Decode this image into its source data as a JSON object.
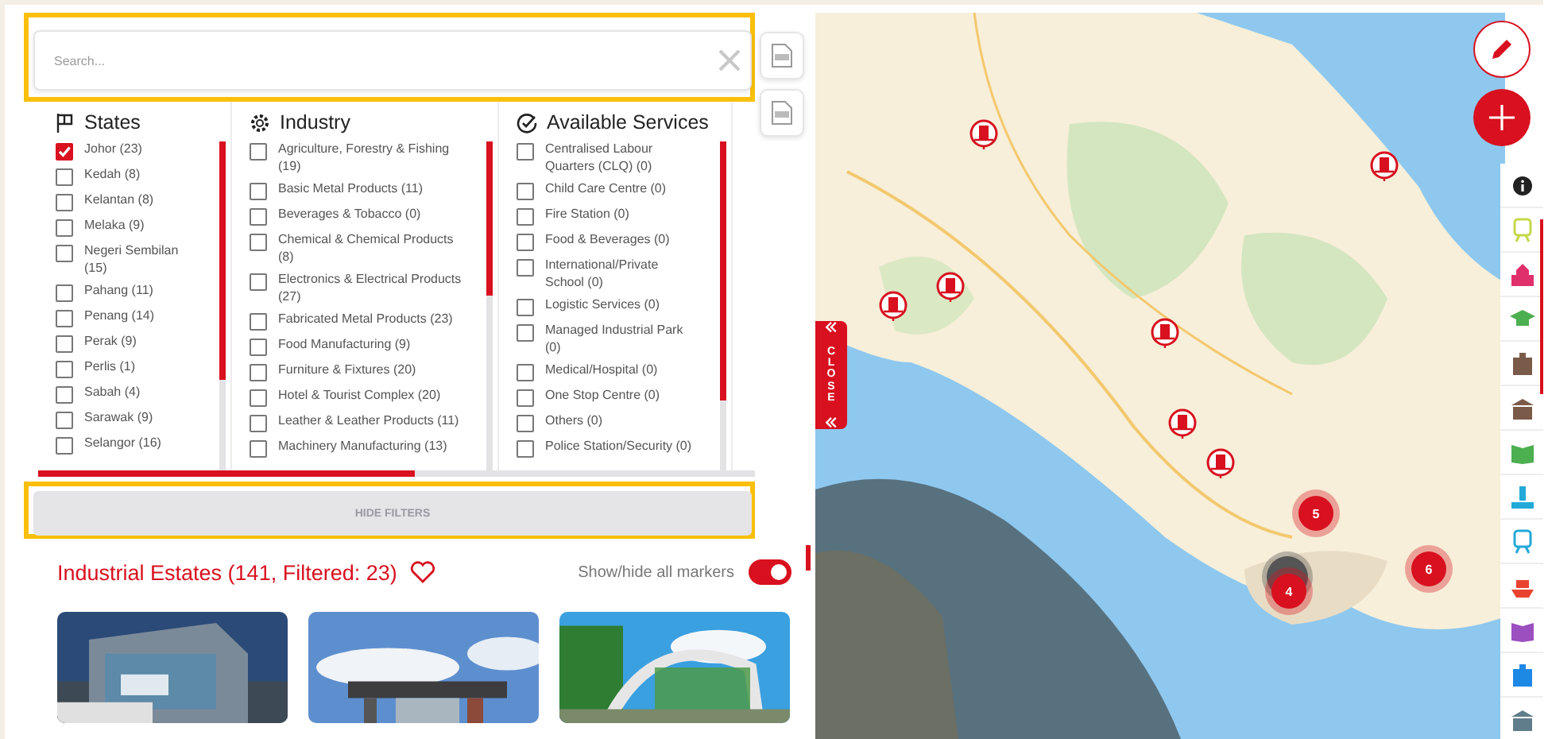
{
  "search": {
    "placeholder": "Search..."
  },
  "filters": [
    {
      "title": "States",
      "kind": "flag",
      "options": [
        {
          "label": "Johor (23)",
          "checked": true
        },
        {
          "label": "Kedah (8)",
          "checked": false
        },
        {
          "label": "Kelantan (8)",
          "checked": false
        },
        {
          "label": "Melaka (9)",
          "checked": false
        },
        {
          "label": "Negeri Sembilan (15)",
          "checked": false
        },
        {
          "label": "Pahang (11)",
          "checked": false
        },
        {
          "label": "Penang (14)",
          "checked": false
        },
        {
          "label": "Perak (9)",
          "checked": false
        },
        {
          "label": "Perlis (1)",
          "checked": false
        },
        {
          "label": "Sabah (4)",
          "checked": false
        },
        {
          "label": "Sarawak (9)",
          "checked": false
        },
        {
          "label": "Selangor (16)",
          "checked": false
        }
      ]
    },
    {
      "title": "Industry",
      "kind": "gear",
      "options": [
        {
          "label": "Agriculture, Forestry & Fishing (19)",
          "checked": false
        },
        {
          "label": "Basic Metal Products (11)",
          "checked": false
        },
        {
          "label": "Beverages & Tobacco (0)",
          "checked": false
        },
        {
          "label": "Chemical & Chemical Products (8)",
          "checked": false
        },
        {
          "label": "Electronics & Electrical Products (27)",
          "checked": false
        },
        {
          "label": "Fabricated Metal Products (23)",
          "checked": false
        },
        {
          "label": "Food Manufacturing (9)",
          "checked": false
        },
        {
          "label": "Furniture & Fixtures (20)",
          "checked": false
        },
        {
          "label": "Hotel & Tourist Complex (20)",
          "checked": false
        },
        {
          "label": "Leather & Leather Products (11)",
          "checked": false
        },
        {
          "label": "Machinery Manufacturing (13)",
          "checked": false
        }
      ]
    },
    {
      "title": "Available Services",
      "kind": "check",
      "options": [
        {
          "label": "Centralised Labour Quarters (CLQ) (0)",
          "checked": false
        },
        {
          "label": "Child Care Centre (0)",
          "checked": false
        },
        {
          "label": "Fire Station (0)",
          "checked": false
        },
        {
          "label": "Food & Beverages (0)",
          "checked": false
        },
        {
          "label": "International/Private School (0)",
          "checked": false
        },
        {
          "label": "Logistic Services (0)",
          "checked": false
        },
        {
          "label": "Managed Industrial Park (0)",
          "checked": false
        },
        {
          "label": "Medical/Hospital (0)",
          "checked": false
        },
        {
          "label": "One Stop Centre (0)",
          "checked": false
        },
        {
          "label": "Others (0)",
          "checked": false
        },
        {
          "label": "Police Station/Security (0)",
          "checked": false
        }
      ]
    }
  ],
  "hide_filters": "HIDE FILTERS",
  "list": {
    "title": "Industrial Estates (141, Filtered: 23)",
    "toggle_label": "Show/hide all markers",
    "markers_on": true
  },
  "map": {
    "close_label": "CLOSE",
    "clusters": [
      {
        "count": "5"
      },
      {
        "count": "4"
      },
      {
        "count": "6"
      }
    ]
  }
}
